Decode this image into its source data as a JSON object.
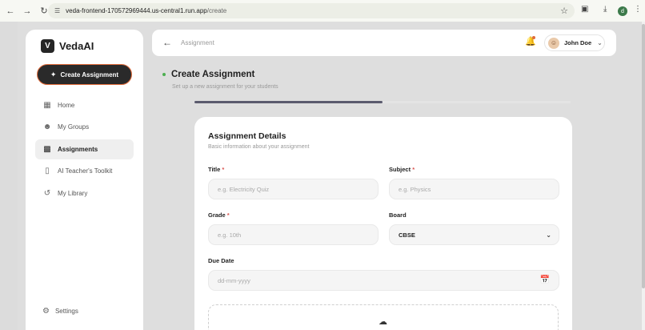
{
  "browser": {
    "url_host": "veda-frontend-170572969444.us-central1.run.app",
    "url_path": "/create",
    "profile_initial": "d"
  },
  "sidebar": {
    "brand": "VedaAI",
    "brand_initial": "V",
    "create_button": "Create Assignment",
    "items": [
      {
        "label": "Home",
        "icon": "grid-icon"
      },
      {
        "label": "My Groups",
        "icon": "users-icon"
      },
      {
        "label": "Assignments",
        "icon": "file-icon",
        "active": true
      },
      {
        "label": "AI Teacher's Toolkit",
        "icon": "tablet-icon"
      },
      {
        "label": "My Library",
        "icon": "history-icon"
      }
    ],
    "settings_label": "Settings"
  },
  "topbar": {
    "breadcrumb": "Assignment",
    "user_name": "John Doe"
  },
  "header": {
    "title": "Create Assignment",
    "subtitle": "Set up a new assignment for your students",
    "progress": 0.5
  },
  "form": {
    "title": "Assignment Details",
    "subtitle": "Basic information about your assignment",
    "required_mark": "*",
    "title_label": "Title",
    "title_placeholder": "e.g. Electricity Quiz",
    "subject_label": "Subject",
    "subject_placeholder": "e.g. Physics",
    "grade_label": "Grade",
    "grade_placeholder": "e.g. 10th",
    "board_label": "Board",
    "board_value": "CBSE",
    "due_label": "Due Date",
    "due_placeholder": "dd-mm-yyyy"
  },
  "colors": {
    "accent": "#e06b3a",
    "dark": "#2a2a2a",
    "status_green": "#4caf50"
  }
}
